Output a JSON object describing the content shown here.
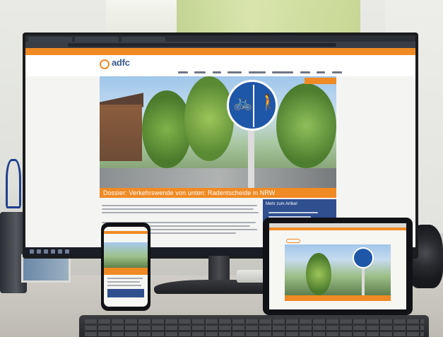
{
  "site": {
    "logo_text": "adfc",
    "hero_caption": "Dossier: Verkehrswende von unten: Radentscheide in NRW",
    "sidebar_title": "Mehr zum Artikel"
  },
  "colors": {
    "brand_orange": "#f08a24",
    "brand_blue": "#2f4f8e",
    "sign_blue": "#1e56a8"
  },
  "icons": {
    "sign_left": "bicycle-icon",
    "sign_right": "pedestrian-icon"
  }
}
